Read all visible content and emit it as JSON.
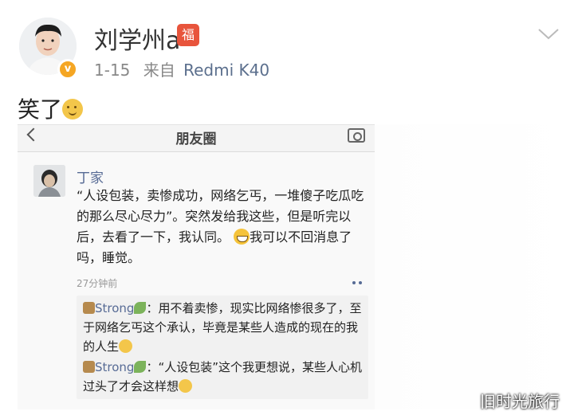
{
  "post": {
    "username": "刘学州a",
    "user_tag": "福",
    "date": "1-15",
    "source_prefix": "来自",
    "source_device": "Redmi K40",
    "verified_mark": "v",
    "text": "笑了"
  },
  "screenshot": {
    "title": "朋友圈",
    "moment": {
      "name": "丁家",
      "text_part1": "“人设包装，卖惨成功，网络乞丐，一堆傻子吃瓜吃的那么尽心尽力”。突然发给我这些，但是听完以后，去看了一下，我认同。",
      "text_part2": "我可以不回消息了吗，睡觉。",
      "time": "27分钟前"
    },
    "comments": [
      {
        "author": "Strong",
        "separator": "：",
        "text": "用不着卖惨，现实比网络惨很多了，至于网络乞丐这个承认，毕竟是某些人造成的现在的我的人生"
      },
      {
        "author": "Strong",
        "separator": "：",
        "text": "“人设包装”这个我更想说，某些人心机过头了才会这样想"
      }
    ]
  },
  "watermark": "旧时光旅行",
  "colors": {
    "link_blue": "#576b95",
    "source_blue": "#5b6f8d",
    "badge_orange": "#f5a623",
    "tag_red": "#e8543c"
  }
}
